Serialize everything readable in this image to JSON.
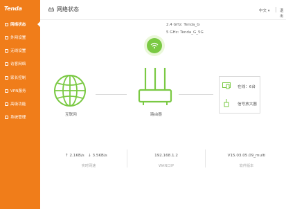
{
  "brand": "Tenda",
  "sidebar": {
    "items": [
      {
        "label": "网络状态"
      },
      {
        "label": "外网设置"
      },
      {
        "label": "无线设置"
      },
      {
        "label": "访客网络"
      },
      {
        "label": "家长控制"
      },
      {
        "label": "VPN服务"
      },
      {
        "label": "高级功能"
      },
      {
        "label": "系统管理"
      }
    ]
  },
  "header": {
    "title": "网络状态",
    "language": "中文",
    "logout": "退出"
  },
  "wifi": {
    "ssid_24": "2.4 GHz: Tenda_G",
    "ssid_5": "5 GHz: Tenda_G_5G"
  },
  "topology": {
    "internet_label": "互联网",
    "router_label": "路由器",
    "online_label": "在线：6台",
    "booster_label": "信号放大器"
  },
  "footer": {
    "upload": "2.1KB/s",
    "download": "3.5KB/s",
    "speed_caption": "实时网速",
    "wan_ip": "192.168.1.2",
    "wan_caption": "WAN口IP",
    "version": "V15.03.05.09_multi",
    "version_caption": "软件版本"
  },
  "colors": {
    "accent": "#f07d1a",
    "green": "#7ac943"
  }
}
